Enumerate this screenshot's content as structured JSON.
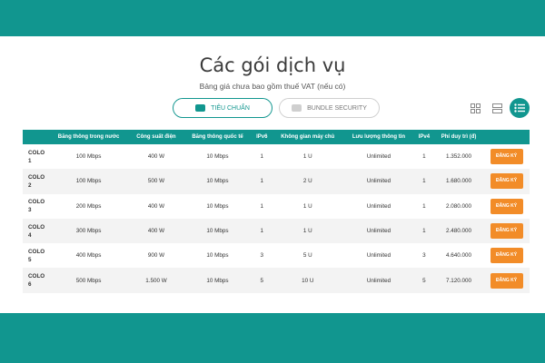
{
  "header": {
    "title": "Các gói dịch vụ",
    "subtitle": "Bảng giá chưa bao gồm thuế VAT (nếu có)"
  },
  "tabs": [
    {
      "label": "TIÊU CHUẨN",
      "active": true
    },
    {
      "label": "BUNDLE SECURITY",
      "active": false
    }
  ],
  "view_toggles": [
    "grid-view-icon",
    "rows-view-icon",
    "list-view-icon"
  ],
  "colors": {
    "accent": "#11968f",
    "button": "#f28c28"
  },
  "table": {
    "columns": [
      "",
      "Băng thông trong nước",
      "Công suất điện",
      "Băng thông quốc tế",
      "IPv6",
      "Không gian máy chủ",
      "Lưu lượng thông tin",
      "IPv4",
      "Phí duy trì (đ)",
      ""
    ],
    "rows": [
      {
        "name": "COLO 1",
        "domestic": "100 Mbps",
        "power": "400 W",
        "intl": "10 Mbps",
        "ipv6": "1",
        "space": "1 U",
        "traffic": "Unlimited",
        "ipv4": "1",
        "fee": "1.352.000",
        "cta": "ĐĂNG KÝ"
      },
      {
        "name": "COLO 2",
        "domestic": "100 Mbps",
        "power": "500 W",
        "intl": "10 Mbps",
        "ipv6": "1",
        "space": "2 U",
        "traffic": "Unlimited",
        "ipv4": "1",
        "fee": "1.680.000",
        "cta": "ĐĂNG KÝ"
      },
      {
        "name": "COLO 3",
        "domestic": "200 Mbps",
        "power": "400 W",
        "intl": "10 Mbps",
        "ipv6": "1",
        "space": "1 U",
        "traffic": "Unlimited",
        "ipv4": "1",
        "fee": "2.080.000",
        "cta": "ĐĂNG KÝ"
      },
      {
        "name": "COLO 4",
        "domestic": "300 Mbps",
        "power": "400 W",
        "intl": "10 Mbps",
        "ipv6": "1",
        "space": "1 U",
        "traffic": "Unlimited",
        "ipv4": "1",
        "fee": "2.480.000",
        "cta": "ĐĂNG KÝ"
      },
      {
        "name": "COLO 5",
        "domestic": "400 Mbps",
        "power": "900 W",
        "intl": "10 Mbps",
        "ipv6": "3",
        "space": "5 U",
        "traffic": "Unlimited",
        "ipv4": "3",
        "fee": "4.640.000",
        "cta": "ĐĂNG KÝ"
      },
      {
        "name": "COLO 6",
        "domestic": "500 Mbps",
        "power": "1.500 W",
        "intl": "10 Mbps",
        "ipv6": "5",
        "space": "10 U",
        "traffic": "Unlimited",
        "ipv4": "5",
        "fee": "7.120.000",
        "cta": "ĐĂNG KÝ"
      }
    ]
  }
}
